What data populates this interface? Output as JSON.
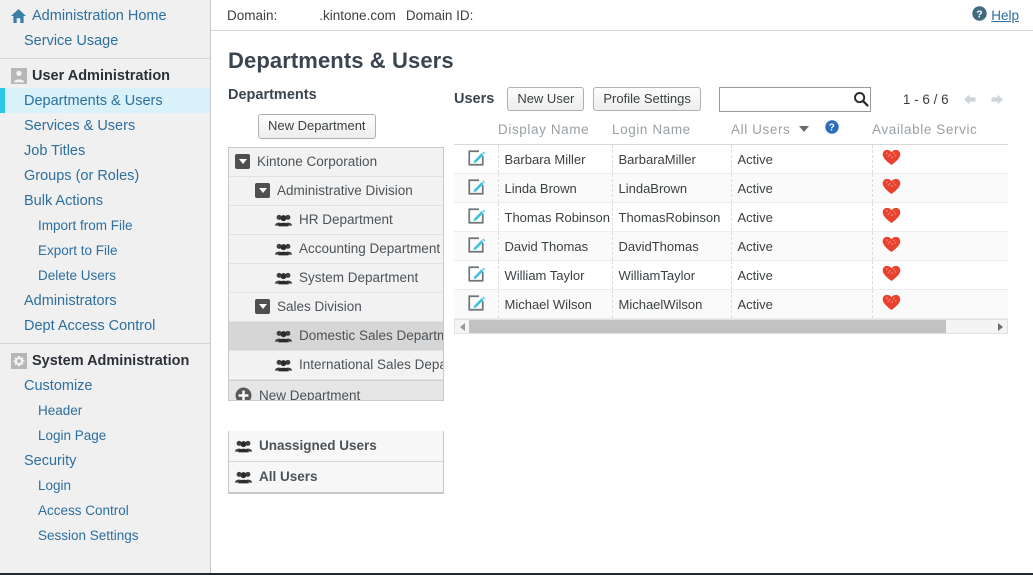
{
  "topbar": {
    "domain_label": "Domain:",
    "domain_value": ".kintone.com",
    "domain_id_label": "Domain ID:",
    "help_label": "Help"
  },
  "page_title": "Departments & Users",
  "sidebar": {
    "groups": [
      {
        "items": [
          {
            "label": "Administration Home",
            "icon": "home-icon",
            "level": 0,
            "head": false,
            "active": false
          },
          {
            "label": "Service Usage",
            "icon": null,
            "level": 1,
            "head": false,
            "active": false
          }
        ]
      },
      {
        "items": [
          {
            "label": "User Administration",
            "icon": "user-icon",
            "level": 0,
            "head": true,
            "active": false
          },
          {
            "label": "Departments & Users",
            "icon": null,
            "level": 1,
            "head": false,
            "active": true
          },
          {
            "label": "Services & Users",
            "icon": null,
            "level": 1,
            "head": false,
            "active": false
          },
          {
            "label": "Job Titles",
            "icon": null,
            "level": 1,
            "head": false,
            "active": false
          },
          {
            "label": "Groups (or Roles)",
            "icon": null,
            "level": 1,
            "head": false,
            "active": false
          },
          {
            "label": "Bulk Actions",
            "icon": null,
            "level": 1,
            "head": false,
            "active": false
          },
          {
            "label": "Import from File",
            "icon": null,
            "level": 2,
            "head": false,
            "active": false
          },
          {
            "label": "Export to File",
            "icon": null,
            "level": 2,
            "head": false,
            "active": false
          },
          {
            "label": "Delete Users",
            "icon": null,
            "level": 2,
            "head": false,
            "active": false
          },
          {
            "label": "Administrators",
            "icon": null,
            "level": 1,
            "head": false,
            "active": false
          },
          {
            "label": "Dept Access Control",
            "icon": null,
            "level": 1,
            "head": false,
            "active": false
          }
        ]
      },
      {
        "items": [
          {
            "label": "System Administration",
            "icon": "gear-icon",
            "level": 0,
            "head": true,
            "active": false
          },
          {
            "label": "Customize",
            "icon": null,
            "level": 1,
            "head": false,
            "active": false
          },
          {
            "label": "Header",
            "icon": null,
            "level": 2,
            "head": false,
            "active": false
          },
          {
            "label": "Login Page",
            "icon": null,
            "level": 2,
            "head": false,
            "active": false
          },
          {
            "label": "Security",
            "icon": null,
            "level": 1,
            "head": false,
            "active": false
          },
          {
            "label": "Login",
            "icon": null,
            "level": 2,
            "head": false,
            "active": false
          },
          {
            "label": "Access Control",
            "icon": null,
            "level": 2,
            "head": false,
            "active": false
          },
          {
            "label": "Session Settings",
            "icon": null,
            "level": 2,
            "head": false,
            "active": false
          }
        ]
      }
    ]
  },
  "departments": {
    "heading": "Departments",
    "new_department_button": "New Department",
    "tree": [
      {
        "label": "Kintone Corporation",
        "depth": 1,
        "icon": "toggle-expanded-icon",
        "selected": false
      },
      {
        "label": "Administrative Division",
        "depth": 2,
        "icon": "toggle-expanded-icon",
        "selected": false
      },
      {
        "label": "HR Department",
        "depth": 3,
        "icon": "group-icon",
        "selected": false
      },
      {
        "label": "Accounting Department",
        "depth": 3,
        "icon": "group-icon",
        "selected": false
      },
      {
        "label": "System Department",
        "depth": 3,
        "icon": "group-icon",
        "selected": false
      },
      {
        "label": "Sales Division",
        "depth": 2,
        "icon": "toggle-expanded-icon",
        "selected": false
      },
      {
        "label": "Domestic Sales Department",
        "depth": 3,
        "icon": "group-icon",
        "selected": true
      },
      {
        "label": "International Sales Department",
        "depth": 3,
        "icon": "group-icon",
        "selected": false
      }
    ],
    "new_department_row": "New Department",
    "special_lists": [
      {
        "label": "Unassigned Users",
        "icon": "group-icon"
      },
      {
        "label": "All Users",
        "icon": "group-icon"
      }
    ]
  },
  "users": {
    "heading": "Users",
    "new_user_button": "New User",
    "profile_settings_button": "Profile Settings",
    "search_value": "",
    "search_placeholder": "",
    "pagination": "1 - 6 / 6",
    "columns": {
      "display_name": "Display Name",
      "login_name": "Login Name",
      "status_filter": "All Users",
      "available_services": "Available Servic"
    },
    "rows": [
      {
        "display_name": "Barbara Miller",
        "login_name": "BarbaraMiller",
        "status": "Active",
        "service": "kintone-heart-icon"
      },
      {
        "display_name": "Linda Brown",
        "login_name": "LindaBrown",
        "status": "Active",
        "service": "kintone-heart-icon"
      },
      {
        "display_name": "Thomas Robinson",
        "login_name": "ThomasRobinson",
        "status": "Active",
        "service": "kintone-heart-icon"
      },
      {
        "display_name": "David Thomas",
        "login_name": "DavidThomas",
        "status": "Active",
        "service": "kintone-heart-icon"
      },
      {
        "display_name": "William Taylor",
        "login_name": "WilliamTaylor",
        "status": "Active",
        "service": "kintone-heart-icon"
      },
      {
        "display_name": "Michael Wilson",
        "login_name": "MichaelWilson",
        "status": "Active",
        "service": "kintone-heart-icon"
      }
    ]
  },
  "colors": {
    "link": "#2d6f9e",
    "accent": "#2ac7e8",
    "active_bg": "#d9f2f9",
    "service_icon": "#e8412e",
    "edit_icon": "#3ec1e0"
  }
}
